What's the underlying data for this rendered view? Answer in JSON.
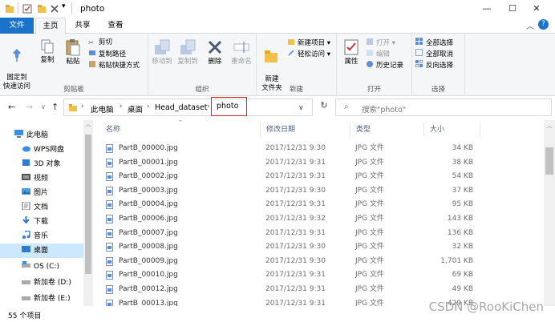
{
  "window": {
    "title": "photo",
    "controls": {
      "minimize": "—",
      "maximize": "☐",
      "close": "✕"
    },
    "quick_access_dropdown": "▾"
  },
  "ribbon_tabs": [
    "文件",
    "主页",
    "共享",
    "查看"
  ],
  "ribbon_toggle": "︿",
  "help_label": "?",
  "clipboard": {
    "label": "剪贴板",
    "pin": "固定到\n快速访问",
    "copy": "复制",
    "paste": "粘贴",
    "cut": "剪切",
    "copy_path": "复制路径",
    "paste_shortcut": "粘贴快捷方式"
  },
  "organize": {
    "label": "组织",
    "move_to": "移动到",
    "copy_to": "复制到",
    "delete": "删除",
    "rename": "重命名"
  },
  "new": {
    "label": "新建",
    "new_folder": "新建\n文件夹",
    "new_item": "新建项目 ▾",
    "easy_access": "轻松访问 ▾"
  },
  "open": {
    "label": "打开",
    "properties": "属性",
    "open": "打开 ▾",
    "edit": "编辑",
    "history": "历史记录"
  },
  "select": {
    "label": "选择",
    "select_all": "全部选择",
    "select_none": "全部取消",
    "invert": "反向选择"
  },
  "address": {
    "nav": {
      "back": "←",
      "forward": "→",
      "recent": "∨",
      "up": "↑"
    },
    "crumbs": [
      "此电脑",
      "桌面",
      "Head_dataset",
      "photo"
    ],
    "dropdown": "∨",
    "refresh": "↻",
    "search_placeholder": "搜索\"photo\""
  },
  "sidebar": {
    "items": [
      {
        "label": "此电脑",
        "icon": "computer-icon"
      },
      {
        "label": "WPS网盘",
        "icon": "cloud-icon"
      },
      {
        "label": "3D 对象",
        "icon": "cube-icon"
      },
      {
        "label": "视频",
        "icon": "video-icon"
      },
      {
        "label": "图片",
        "icon": "picture-icon"
      },
      {
        "label": "文档",
        "icon": "document-icon"
      },
      {
        "label": "下载",
        "icon": "download-icon"
      },
      {
        "label": "音乐",
        "icon": "music-icon"
      },
      {
        "label": "桌面",
        "icon": "desktop-icon"
      },
      {
        "label": "OS (C:)",
        "icon": "drive-icon"
      },
      {
        "label": "新加卷 (D:)",
        "icon": "drive-icon"
      },
      {
        "label": "新加卷 (E:)",
        "icon": "drive-icon"
      }
    ],
    "scroll_up": "︿"
  },
  "file_list": {
    "columns": [
      "名称",
      "修改日期",
      "类型",
      "大小"
    ],
    "sort_indicator": "^",
    "rows": [
      {
        "name": "PartB_00000.jpg",
        "date": "2017/12/31 9:30",
        "type": "JPG 文件",
        "size": "34 KB"
      },
      {
        "name": "PartB_00001.jpg",
        "date": "2017/12/31 9:31",
        "type": "JPG 文件",
        "size": "38 KB"
      },
      {
        "name": "PartB_00002.jpg",
        "date": "2017/12/31 9:31",
        "type": "JPG 文件",
        "size": "54 KB"
      },
      {
        "name": "PartB_00003.jpg",
        "date": "2017/12/31 9:30",
        "type": "JPG 文件",
        "size": "37 KB"
      },
      {
        "name": "PartB_00004.jpg",
        "date": "2017/12/31 9:31",
        "type": "JPG 文件",
        "size": "95 KB"
      },
      {
        "name": "PartB_00006.jpg",
        "date": "2017/12/31 9:32",
        "type": "JPG 文件",
        "size": "143 KB"
      },
      {
        "name": "PartB_00007.jpg",
        "date": "2017/12/31 9:31",
        "type": "JPG 文件",
        "size": "136 KB"
      },
      {
        "name": "PartB_00008.jpg",
        "date": "2017/12/31 9:30",
        "type": "JPG 文件",
        "size": "32 KB"
      },
      {
        "name": "PartB_00009.jpg",
        "date": "2017/12/31 9:30",
        "type": "JPG 文件",
        "size": "1,701 KB"
      },
      {
        "name": "PartB_00010.jpg",
        "date": "2017/12/31 9:31",
        "type": "JPG 文件",
        "size": "69 KB"
      },
      {
        "name": "PartB_00012.jpg",
        "date": "2017/12/31 9:31",
        "type": "JPG 文件",
        "size": "49 KB"
      },
      {
        "name": "PartB_00013.jpg",
        "date": "2017/12/31 9:31",
        "type": "JPG 文件",
        "size": "429 KB"
      }
    ]
  },
  "status": {
    "item_count": "55 个项目"
  },
  "watermark": "CSDN @RooKiChen",
  "colors": {
    "accent": "#1a73c8",
    "selected": "#cce8ff",
    "highlight_box": "#e11d1d",
    "folder": "#f0c048"
  }
}
